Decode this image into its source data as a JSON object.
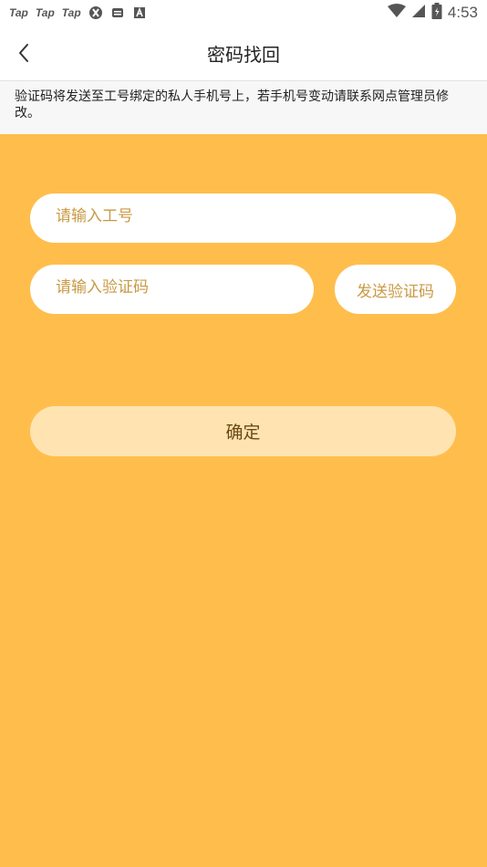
{
  "status_bar": {
    "app_icons": [
      "Tap",
      "Tap",
      "Tap"
    ],
    "time": "4:53",
    "icons": [
      "app-icon",
      "mail-icon",
      "a-icon",
      "wifi-icon",
      "signal-icon",
      "battery-icon"
    ]
  },
  "nav": {
    "title": "密码找回",
    "back_icon": "chevron-left-icon"
  },
  "notice": {
    "text": "验证码将发送至工号绑定的私人手机号上，若手机号变动请联系网点管理员修改。"
  },
  "form": {
    "workid_placeholder": "请输入工号",
    "workid_value": "",
    "code_placeholder": "请输入验证码",
    "code_value": "",
    "send_code_label": "发送验证码",
    "confirm_label": "确定"
  },
  "colors": {
    "background": "#ffbe4c",
    "placeholder": "#c99a44",
    "confirm_bg": "#ffe4b2",
    "confirm_text": "#6b4a12"
  }
}
